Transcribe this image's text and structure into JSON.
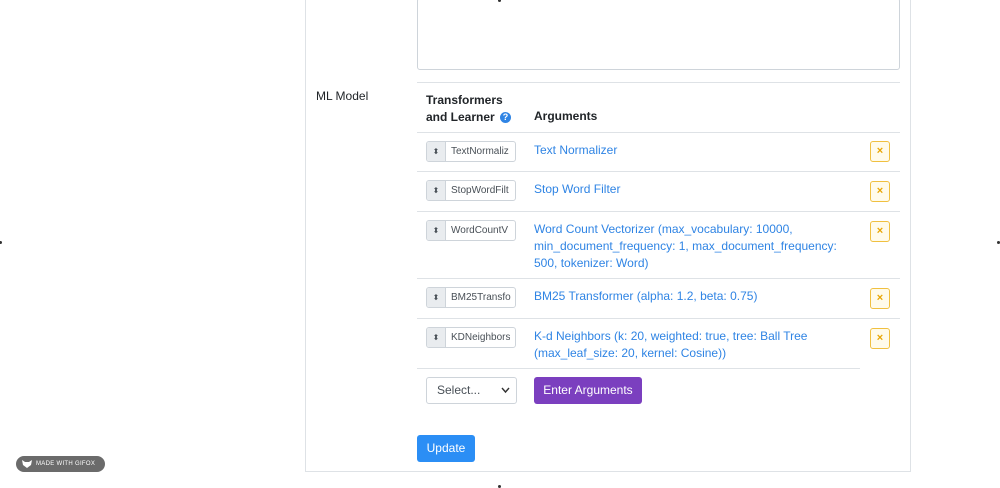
{
  "form": {
    "ml_model_label": "ML Model",
    "columns": {
      "transformers_learner_line1": "Transformers",
      "transformers_learner_line2": "and Learner",
      "help_icon": "?",
      "arguments": "Arguments"
    },
    "rows": [
      {
        "handle_text": "TextNormaliz",
        "arguments": "Text Normalizer"
      },
      {
        "handle_text": "StopWordFilt",
        "arguments": "Stop Word Filter"
      },
      {
        "handle_text": "WordCountV",
        "arguments": "Word Count Vectorizer (max_vocabulary: 10000, min_document_frequency: 1, max_document_frequency: 500, tokenizer: Word)"
      },
      {
        "handle_text": "BM25Transfo",
        "arguments": "BM25 Transformer (alpha: 1.2, beta: 0.75)"
      },
      {
        "handle_text": "KDNeighbors",
        "arguments": "K-d Neighbors (k: 20, weighted: true, tree: Ball Tree (max_leaf_size: 20, kernel: Cosine))"
      }
    ],
    "remove_glyph": "×",
    "sort_glyph": "⬍",
    "select_value": "Select...",
    "enter_arguments_label": "Enter Arguments",
    "update_label": "Update"
  },
  "watermark": {
    "text": "MADE WITH GIFOX"
  },
  "colors": {
    "link": "#2f84e4",
    "purple": "#7b3fbf",
    "primary": "#2b8ef5",
    "warning": "#f0c040"
  }
}
